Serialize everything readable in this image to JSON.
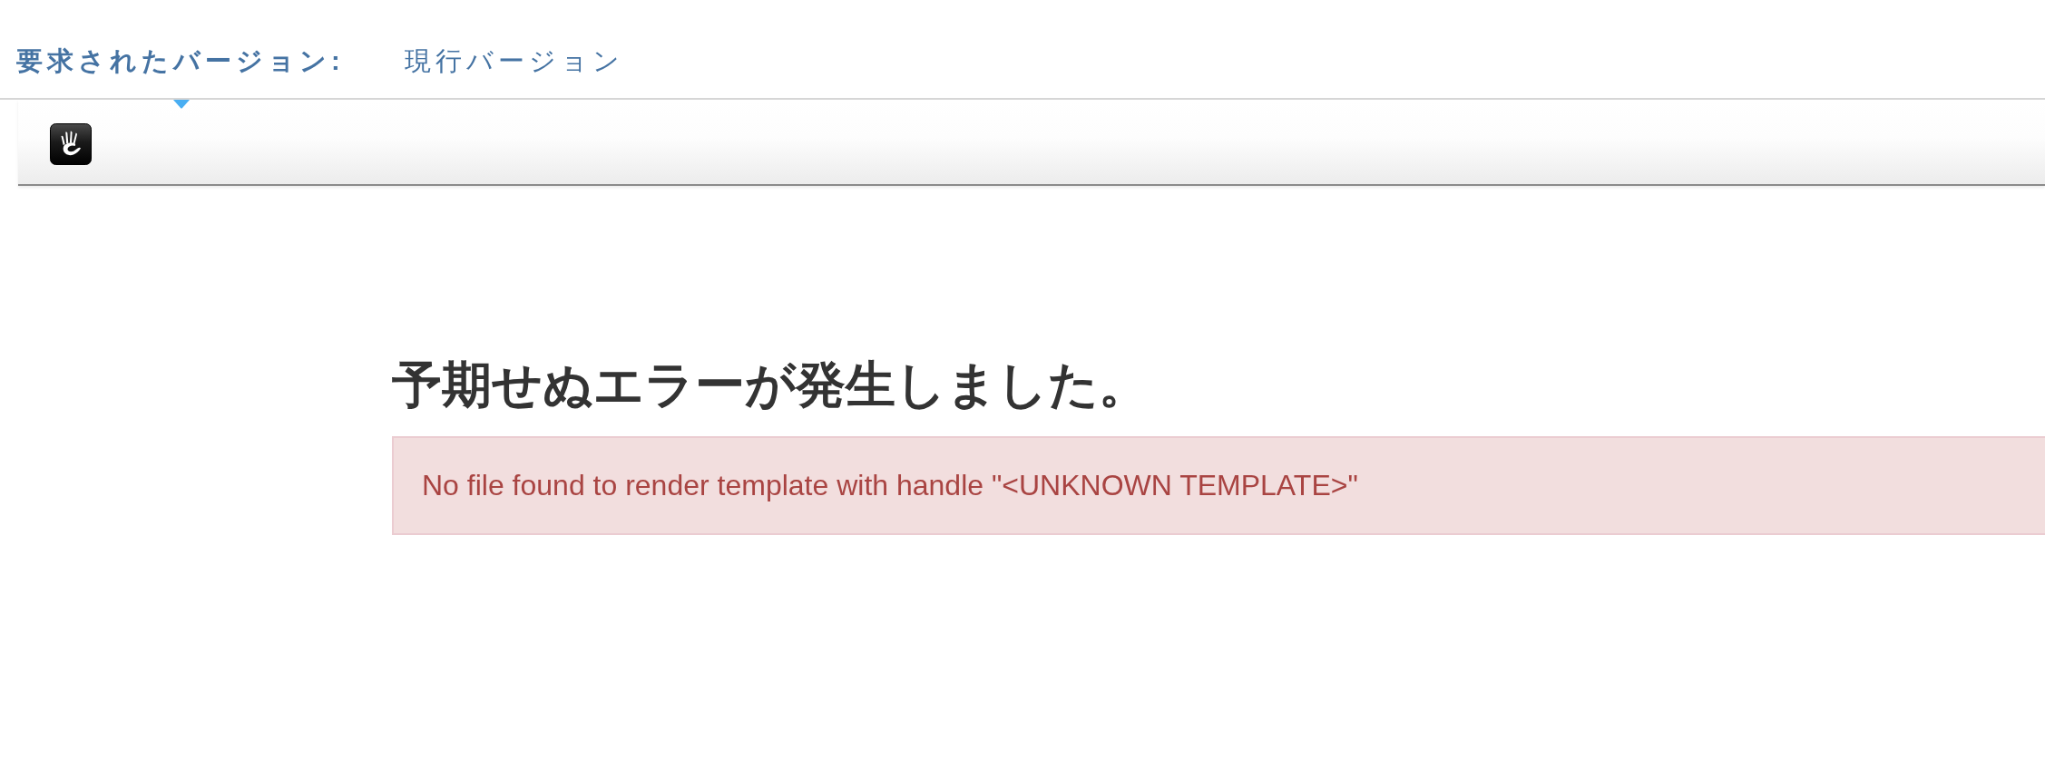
{
  "version_bar": {
    "label": "要求されたバージョン:",
    "value": "現行バージョン"
  },
  "error": {
    "title": "予期せぬエラーが発生しました。",
    "message": "No file found to render template with handle \"<UNKNOWN TEMPLATE>\""
  }
}
